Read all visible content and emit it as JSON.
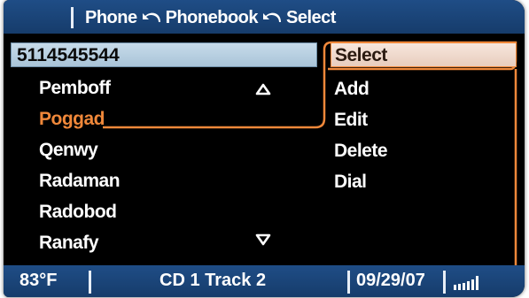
{
  "header": {
    "crumbs": [
      "Phone",
      "Phonebook",
      "Select"
    ],
    "back_icon": "back-arrow-icon"
  },
  "number_field": {
    "value": "5114545544"
  },
  "contacts": {
    "items": [
      {
        "name": "Pemboff",
        "selected": false
      },
      {
        "name": "Poggad",
        "selected": true
      },
      {
        "name": "Qenwy",
        "selected": false
      },
      {
        "name": "Radaman",
        "selected": false
      },
      {
        "name": "Radobod",
        "selected": false
      },
      {
        "name": "Ranafy",
        "selected": false
      }
    ],
    "scroll_up_icon": "triangle-up-icon",
    "scroll_down_icon": "triangle-down-icon"
  },
  "menu": {
    "items": [
      {
        "label": "Select",
        "active": true
      },
      {
        "label": "Add",
        "active": false
      },
      {
        "label": "Edit",
        "active": false
      },
      {
        "label": "Delete",
        "active": false
      },
      {
        "label": "Dial",
        "active": false
      }
    ]
  },
  "status": {
    "temperature": "83°F",
    "media": "CD 1 Track 2",
    "date": "09/29/07",
    "signal_icon": "signal-strength-icon"
  },
  "colors": {
    "bar_blue": "#1f4d86",
    "highlight_orange": "#f0883a",
    "field_blue": "#c7dbea",
    "background": "#000000"
  }
}
